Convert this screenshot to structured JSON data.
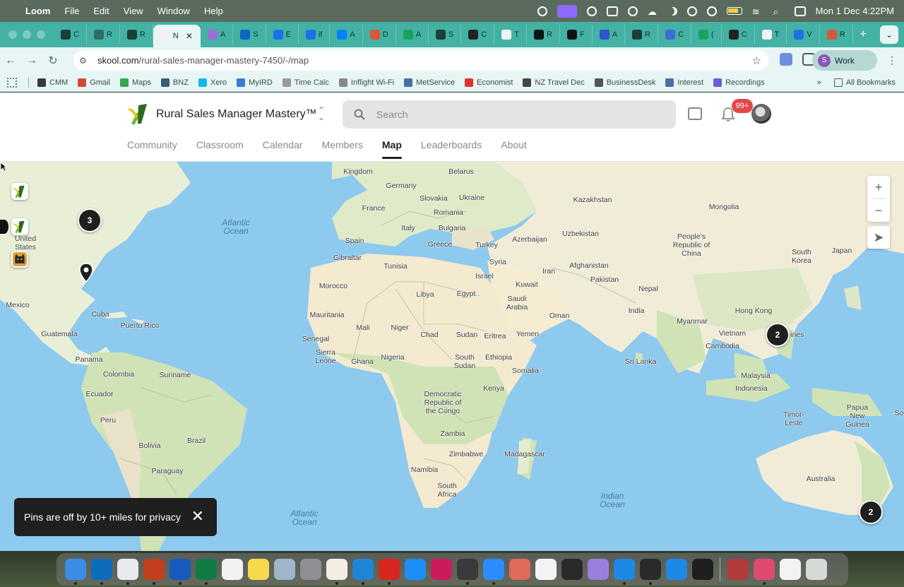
{
  "menubar": {
    "app_name": "Loom",
    "menus": [
      "File",
      "Edit",
      "View",
      "Window",
      "Help"
    ],
    "clock": "Mon 1 Dec  4:22PM"
  },
  "browser": {
    "tabs": [
      {
        "label": "C"
      },
      {
        "label": "R"
      },
      {
        "label": "R"
      },
      {
        "label": "N",
        "active": true
      },
      {
        "label": "A"
      },
      {
        "label": "S"
      },
      {
        "label": "E"
      },
      {
        "label": "if"
      },
      {
        "label": "A"
      },
      {
        "label": "D"
      },
      {
        "label": "A"
      },
      {
        "label": "S"
      },
      {
        "label": "C"
      },
      {
        "label": "T"
      },
      {
        "label": "R"
      },
      {
        "label": "F"
      },
      {
        "label": "A"
      },
      {
        "label": "R"
      },
      {
        "label": "C"
      },
      {
        "label": "("
      },
      {
        "label": "C"
      },
      {
        "label": "T"
      },
      {
        "label": "V"
      },
      {
        "label": "R"
      }
    ],
    "url_host": "skool.com",
    "url_path": "/rural-sales-manager-mastery-7450/-/map",
    "profile_label": "Work",
    "profile_initial": "S",
    "bookmarks": [
      "CMM",
      "Gmail",
      "Maps",
      "BNZ",
      "Xero",
      "MyIRD",
      "Time Calc",
      "Inflight Wi-Fi",
      "MetService",
      "Economist",
      "NZ Travel Dec",
      "BusinessDesk",
      "Interest",
      "Recordings"
    ],
    "all_bookmarks": "All Bookmarks"
  },
  "site": {
    "community_name": "Rural Sales Manager Mastery™",
    "search_placeholder": "Search",
    "notification_badge": "99+",
    "nav": [
      {
        "label": "Community"
      },
      {
        "label": "Classroom"
      },
      {
        "label": "Calendar"
      },
      {
        "label": "Members"
      },
      {
        "label": "Map",
        "active": true
      },
      {
        "label": "Leaderboards"
      },
      {
        "label": "About"
      }
    ]
  },
  "map": {
    "clusters": [
      {
        "id": "usa-east",
        "count": "3"
      },
      {
        "id": "philippines",
        "count": "2"
      },
      {
        "id": "new-zealand",
        "count": "2"
      }
    ],
    "labels": {
      "united_kingdom": "Kingdom",
      "belarus": "Belarus",
      "germany": "Germany",
      "slovakia": "Slovakia",
      "ukraine": "Ukraine",
      "kazakhstan": "Kazakhstan",
      "mongolia": "Mongolia",
      "france": "France",
      "romania": "Romania",
      "italy": "Italy",
      "bulgaria": "Bulgaria",
      "spain": "Spain",
      "uzbekistan": "Uzbekistan",
      "azerbaijan": "Azerbaijan",
      "greece": "Greece",
      "turkey": "Turkey",
      "china": "People's Republic of China",
      "south_korea": "South Korea",
      "japan": "Japan",
      "gibraltar": "Gibraltar",
      "syria": "Syria",
      "afghanistan": "Afghanistan",
      "iran": "Iran",
      "israel": "Israel",
      "tunisia": "Tunisia",
      "morocco": "Morocco",
      "pakistan": "Pakistan",
      "kuwait": "Kuwait",
      "nepal": "Nepal",
      "libya": "Libya",
      "egypt": "Egypt",
      "saudi_arabia": "Saudi Arabia",
      "oman": "Oman",
      "india": "India",
      "hong_kong": "Hong Kong",
      "myanmar": "Myanmar",
      "mauritania": "Mauritania",
      "mali": "Mali",
      "niger": "Niger",
      "chad": "Chad",
      "sudan": "Sudan",
      "eritrea": "Eritrea",
      "yemen": "Yemen",
      "vietnam": "Vietnam",
      "philippines": "Philippines",
      "senegal": "Senegal",
      "cambodia": "Cambodia",
      "sierra_leone": "Sierra Leone",
      "ghana": "Ghana",
      "nigeria": "Nigeria",
      "south_sudan": "South Sudan",
      "ethiopia": "Ethiopia",
      "somalia": "Somalia",
      "sri_lanka": "Sri Lanka",
      "malaysia": "Malaysia",
      "indonesia": "Indonesia",
      "drc": "Democratic Republic of the Congo",
      "kenya": "Kenya",
      "papua_new_guinea": "Papua New Guinea",
      "timor_leste": "Timor-Leste",
      "zambia": "Zambia",
      "zimbabwe": "Zimbabwe",
      "madagascar": "Madagascar",
      "namibia": "Namibia",
      "south_africa": "South Africa",
      "australia": "Australia",
      "mexico": "Mexico",
      "cuba": "Cuba",
      "puerto_rico": "Puerto Rico",
      "guatemala": "Guatemala",
      "panama": "Panama",
      "colombia": "Colombia",
      "suriname": "Suriname",
      "ecuador": "Ecuador",
      "peru": "Peru",
      "brazil": "Brazil",
      "bolivia": "Bolivia",
      "paraguay": "Paraguay",
      "united_states": "United States",
      "atlantic_north": "Atlantic Ocean",
      "atlantic_south": "Atlantic Ocean",
      "indian_ocean": "Indian Ocean",
      "edge_so": "So"
    },
    "privacy_toast": "Pins are off by 10+ miles for privacy"
  },
  "colors": {
    "ocean": "#8ec9ee",
    "land": "#f1ecdd",
    "vegetation": "#cfe3b6",
    "desert": "#f4ead0",
    "tab_bar": "#43b1a4",
    "badge": "#e24848"
  }
}
